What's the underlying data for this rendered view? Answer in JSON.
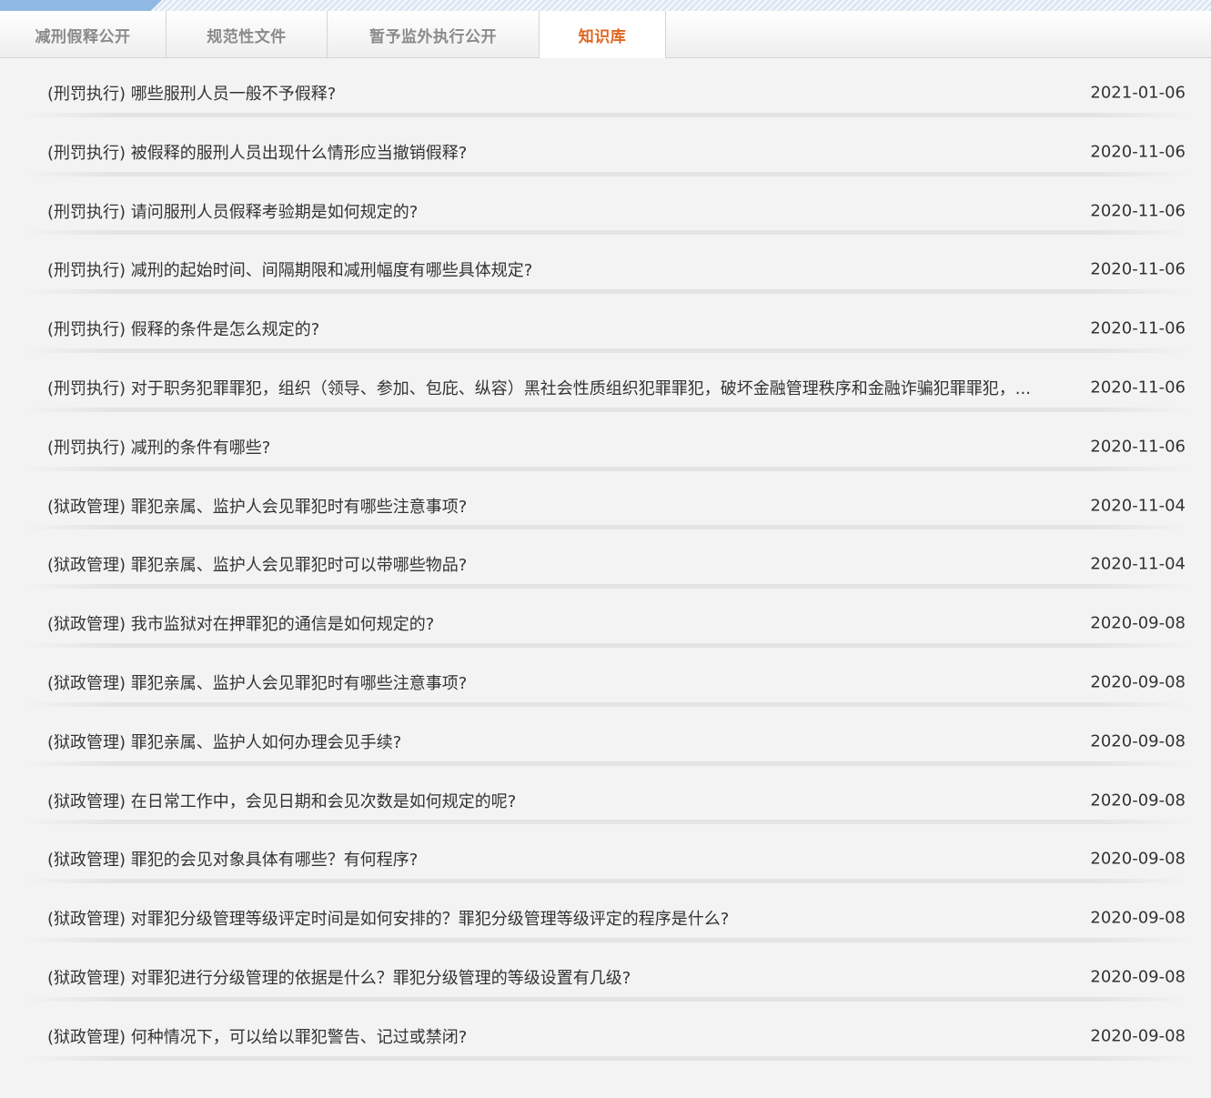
{
  "tabs": [
    {
      "label": "减刑假释公开",
      "active": false
    },
    {
      "label": "规范性文件",
      "active": false
    },
    {
      "label": "暂予监外执行公开",
      "active": false
    },
    {
      "label": "知识库",
      "active": true
    }
  ],
  "colors": {
    "active_tab": "#e0651f",
    "inactive_tab": "#8a8a8a",
    "text": "#333333",
    "background": "#f4f3f3"
  },
  "items": [
    {
      "title": "(刑罚执行) 哪些服刑人员一般不予假释?",
      "date": "2021-01-06"
    },
    {
      "title": "(刑罚执行) 被假释的服刑人员出现什么情形应当撤销假释?",
      "date": "2020-11-06"
    },
    {
      "title": "(刑罚执行) 请问服刑人员假释考验期是如何规定的?",
      "date": "2020-11-06"
    },
    {
      "title": "(刑罚执行) 减刑的起始时间、间隔期限和减刑幅度有哪些具体规定?",
      "date": "2020-11-06"
    },
    {
      "title": "(刑罚执行) 假释的条件是怎么规定的?",
      "date": "2020-11-06"
    },
    {
      "title": "(刑罚执行) 对于职务犯罪罪犯，组织（领导、参加、包庇、纵容）黑社会性质组织犯罪罪犯，破坏金融管理秩序和金融诈骗犯罪罪犯，...",
      "date": "2020-11-06"
    },
    {
      "title": "(刑罚执行) 减刑的条件有哪些?",
      "date": "2020-11-06"
    },
    {
      "title": "(狱政管理) 罪犯亲属、监护人会见罪犯时有哪些注意事项?",
      "date": "2020-11-04"
    },
    {
      "title": "(狱政管理) 罪犯亲属、监护人会见罪犯时可以带哪些物品?",
      "date": "2020-11-04"
    },
    {
      "title": "(狱政管理) 我市监狱对在押罪犯的通信是如何规定的?",
      "date": "2020-09-08"
    },
    {
      "title": "(狱政管理) 罪犯亲属、监护人会见罪犯时有哪些注意事项?",
      "date": "2020-09-08"
    },
    {
      "title": "(狱政管理) 罪犯亲属、监护人如何办理会见手续?",
      "date": "2020-09-08"
    },
    {
      "title": "(狱政管理) 在日常工作中，会见日期和会见次数是如何规定的呢?",
      "date": "2020-09-08"
    },
    {
      "title": "(狱政管理) 罪犯的会见对象具体有哪些？有何程序?",
      "date": "2020-09-08"
    },
    {
      "title": "(狱政管理) 对罪犯分级管理等级评定时间是如何安排的？罪犯分级管理等级评定的程序是什么?",
      "date": "2020-09-08"
    },
    {
      "title": "(狱政管理) 对罪犯进行分级管理的依据是什么？罪犯分级管理的等级设置有几级?",
      "date": "2020-09-08"
    },
    {
      "title": "(狱政管理) 何种情况下，可以给以罪犯警告、记过或禁闭?",
      "date": "2020-09-08"
    }
  ]
}
